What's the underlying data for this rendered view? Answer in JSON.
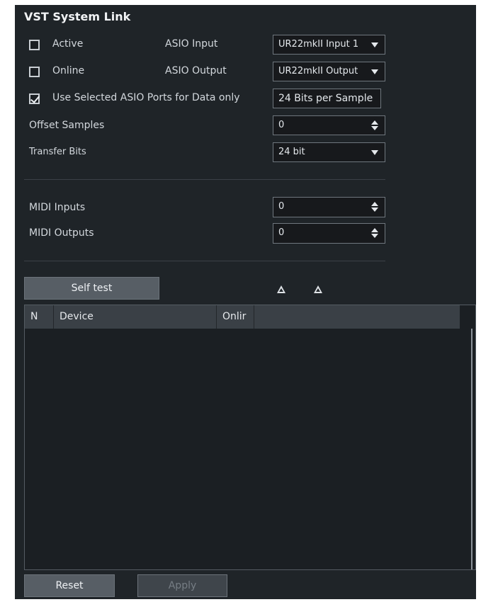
{
  "panel": {
    "title": "VST System Link"
  },
  "options": {
    "active_label": "Active",
    "active_checked": false,
    "online_label": "Online",
    "online_checked": false,
    "use_selected_label": "Use Selected ASIO Ports for Data only",
    "use_selected_checked": true
  },
  "asio": {
    "input_label": "ASIO Input",
    "input_value": "UR22mkII Input 1",
    "output_label": "ASIO Output",
    "output_value": "UR22mkII Output",
    "bits_per_sample": "24 Bits per Sample"
  },
  "offset": {
    "label": "Offset Samples",
    "value": "0"
  },
  "transfer": {
    "label": "Transfer Bits",
    "value": "24 bit"
  },
  "midi": {
    "inputs_label": "MIDI Inputs",
    "inputs_value": "0",
    "outputs_label": "MIDI Outputs",
    "outputs_value": "0"
  },
  "self_test_label": "Self test",
  "table": {
    "columns": [
      "N",
      "Device",
      "Onlir"
    ],
    "rows": []
  },
  "footer": {
    "reset_label": "Reset",
    "apply_label": "Apply"
  },
  "icons": [
    "checkbox-icon",
    "dropdown-arrow-icon",
    "spinner-icon",
    "activity-triangle-icon"
  ]
}
